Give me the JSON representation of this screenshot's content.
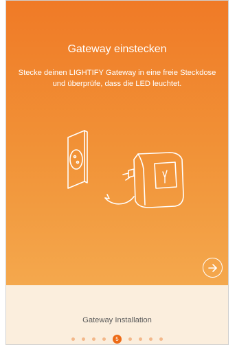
{
  "screen": {
    "title": "Gateway einstecken",
    "subtitle": "Stecke deinen LIGHTIFY Gateway in eine freie Steckdose und überprüfe, dass die LED leuchtet."
  },
  "illustration": {
    "icon": "plug-gateway-illustration"
  },
  "next_button": {
    "icon": "arrow-right-circle-icon"
  },
  "footer": {
    "label": "Gateway Installation",
    "pagination": {
      "current": "5",
      "total": 9
    }
  },
  "colors": {
    "gradient_top": "#f07a26",
    "gradient_bottom": "#f4a84d",
    "footer_bg": "#fbeedd",
    "accent": "#ed6b17"
  }
}
